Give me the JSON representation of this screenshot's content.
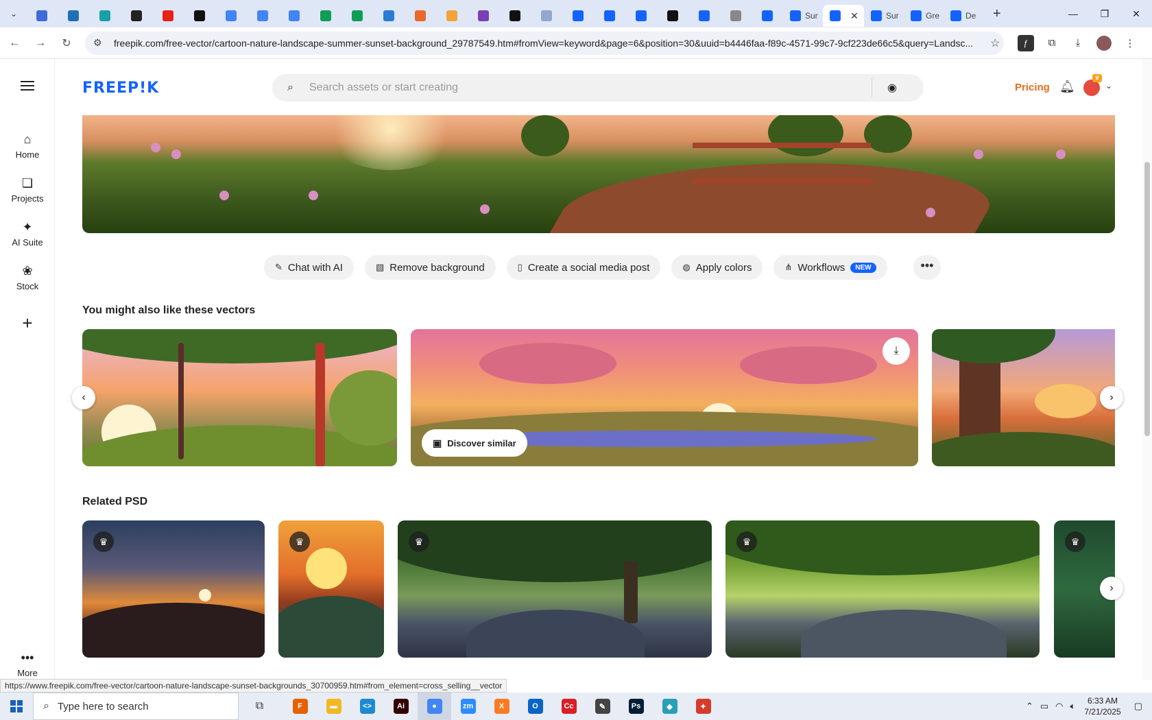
{
  "browser": {
    "tabs": [
      {
        "icon": "tab-favicon",
        "color": "#3f6ad8"
      },
      {
        "icon": "tab-favicon",
        "color": "#1f6fb5"
      },
      {
        "icon": "tab-favicon",
        "color": "#19a0a8"
      },
      {
        "icon": "tab-favicon",
        "color": "#222222"
      },
      {
        "icon": "tab-favicon",
        "color": "#e62117"
      },
      {
        "icon": "tab-favicon",
        "color": "#111111"
      },
      {
        "icon": "tab-favicon",
        "color": "#4285f4"
      },
      {
        "icon": "tab-favicon",
        "color": "#4285f4"
      },
      {
        "icon": "tab-favicon",
        "color": "#4285f4"
      },
      {
        "icon": "tab-favicon",
        "color": "#0f9d58"
      },
      {
        "icon": "tab-favicon",
        "color": "#0f9d58"
      },
      {
        "icon": "tab-favicon",
        "color": "#2b7cd3"
      },
      {
        "icon": "tab-favicon",
        "color": "#e8692a"
      },
      {
        "icon": "tab-favicon",
        "color": "#f2a33a"
      },
      {
        "icon": "tab-favicon",
        "color": "#7b3fb3"
      },
      {
        "icon": "tab-favicon",
        "color": "#111111"
      },
      {
        "icon": "tab-favicon",
        "color": "#8fa8cc"
      },
      {
        "icon": "tab-favicon",
        "color": "#1463ff"
      },
      {
        "icon": "tab-favicon",
        "color": "#1463ff"
      },
      {
        "icon": "tab-favicon",
        "color": "#1463ff"
      },
      {
        "icon": "tab-favicon",
        "color": "#111111"
      },
      {
        "icon": "tab-favicon",
        "color": "#1463ff"
      },
      {
        "icon": "tab-favicon",
        "color": "#888888"
      },
      {
        "icon": "tab-favicon",
        "color": "#1463ff"
      }
    ],
    "labeled_tabs": [
      {
        "label": "Sur",
        "active": false
      },
      {
        "label": "",
        "active": true
      },
      {
        "label": "Sur",
        "active": false
      },
      {
        "label": "Gre",
        "active": false
      },
      {
        "label": "De",
        "active": false
      }
    ],
    "url": "freepik.com/free-vector/cartoon-nature-landscape-summer-sunset-background_29787549.htm#fromView=keyword&page=6&position=30&uuid=b4446faa-f89c-4571-99c7-9cf223de66c5&query=Landsc...",
    "status_url": "https://www.freepik.com/free-vector/cartoon-nature-landscape-sunset-backgrounds_30700959.htm#from_element=cross_selling__vector"
  },
  "rail": {
    "items": [
      {
        "label": "Home",
        "icon": "home-icon"
      },
      {
        "label": "Projects",
        "icon": "projects-icon"
      },
      {
        "label": "AI Suite",
        "icon": "sparkles-icon"
      },
      {
        "label": "Stock",
        "icon": "stock-icon"
      }
    ],
    "more_label": "More"
  },
  "header": {
    "logo": "FREEP!K",
    "search_placeholder": "Search assets or start creating",
    "pricing_label": "Pricing",
    "brand_color": "#1463ff",
    "pricing_color": "#e66d1f"
  },
  "actions": [
    {
      "label": "Chat with AI",
      "icon": "chat-edit-icon"
    },
    {
      "label": "Remove background",
      "icon": "remove-bg-icon"
    },
    {
      "label": "Create a social media post",
      "icon": "phone-icon"
    },
    {
      "label": "Apply colors",
      "icon": "palette-icon"
    },
    {
      "label": "Workflows",
      "icon": "workflow-icon",
      "badge": "NEW"
    }
  ],
  "sections": {
    "vectors_title": "You might also like these vectors",
    "psd_title": "Related PSD",
    "discover_label": "Discover similar"
  },
  "taskbar": {
    "search_placeholder": "Type here to search",
    "apps": [
      {
        "name": "firefox",
        "color": "#e66000",
        "glyph": "F"
      },
      {
        "name": "file-explorer",
        "color": "#f2b824",
        "glyph": "▬"
      },
      {
        "name": "vscode",
        "color": "#1f8ad2",
        "glyph": "<>"
      },
      {
        "name": "illustrator",
        "color": "#330000",
        "glyph": "Ai"
      },
      {
        "name": "chrome",
        "color": "#4285f4",
        "glyph": "●"
      },
      {
        "name": "zoom",
        "color": "#2d8cff",
        "glyph": "zm"
      },
      {
        "name": "xampp",
        "color": "#fb7a24",
        "glyph": "X"
      },
      {
        "name": "outlook",
        "color": "#0a64c8",
        "glyph": "O"
      },
      {
        "name": "creative-cloud",
        "color": "#da1f26",
        "glyph": "Cc"
      },
      {
        "name": "pen-tool",
        "color": "#444444",
        "glyph": "✎"
      },
      {
        "name": "photoshop",
        "color": "#001e36",
        "glyph": "Ps"
      },
      {
        "name": "app-gem",
        "color": "#2a9fb8",
        "glyph": "◆"
      },
      {
        "name": "app-figure",
        "color": "#d43b2a",
        "glyph": "✦"
      }
    ],
    "time": "6:33 AM",
    "date": "7/21/2025"
  }
}
